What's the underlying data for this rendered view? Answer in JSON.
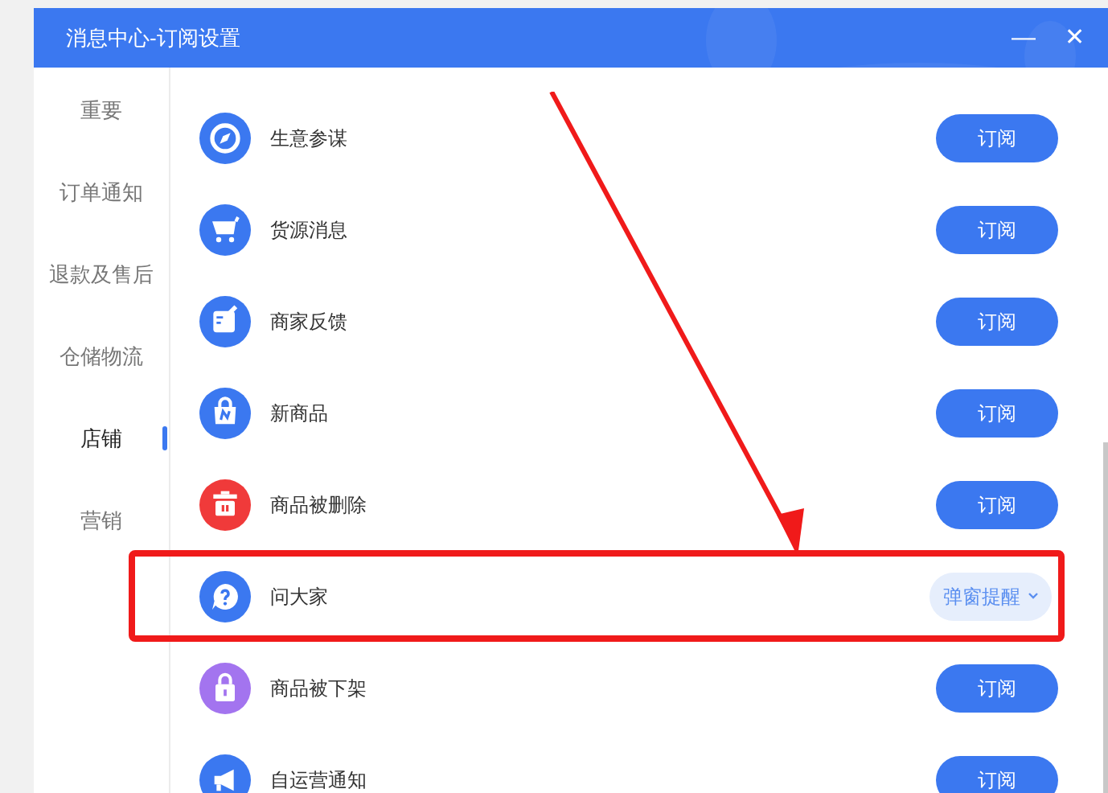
{
  "window": {
    "title": "消息中心-订阅设置",
    "controls": [
      "—",
      "✕"
    ]
  },
  "sidebar": {
    "items": [
      {
        "label": "重要",
        "selected": false
      },
      {
        "label": "订单通知",
        "selected": false
      },
      {
        "label": "退款及售后",
        "selected": false
      },
      {
        "label": "仓储物流",
        "selected": false
      },
      {
        "label": "店铺",
        "selected": true
      },
      {
        "label": "营销",
        "selected": false
      }
    ]
  },
  "rows": [
    {
      "color": "#3b78f0",
      "label": "生意参谋",
      "kind": "button",
      "action": "订阅",
      "highlighted": false
    },
    {
      "color": "#3b78f0",
      "label": "货源消息",
      "kind": "button",
      "action": "订阅",
      "highlighted": false
    },
    {
      "color": "#3b78f0",
      "label": "商家反馈",
      "kind": "button",
      "action": "订阅",
      "highlighted": false
    },
    {
      "color": "#3b78f0",
      "label": "新商品",
      "kind": "button",
      "action": "订阅",
      "highlighted": false
    },
    {
      "color": "#f03a3a",
      "label": "商品被删除",
      "kind": "button",
      "action": "订阅",
      "highlighted": false
    },
    {
      "color": "#3b78f0",
      "label": "问大家",
      "kind": "dropdown",
      "action": "弹窗提醒",
      "highlighted": true
    },
    {
      "color": "#a374ef",
      "label": "商品被下架",
      "kind": "button",
      "action": "订阅",
      "highlighted": false
    },
    {
      "color": "#3b78f0",
      "label": "自运营通知",
      "kind": "button",
      "action": "订阅",
      "highlighted": false
    }
  ]
}
